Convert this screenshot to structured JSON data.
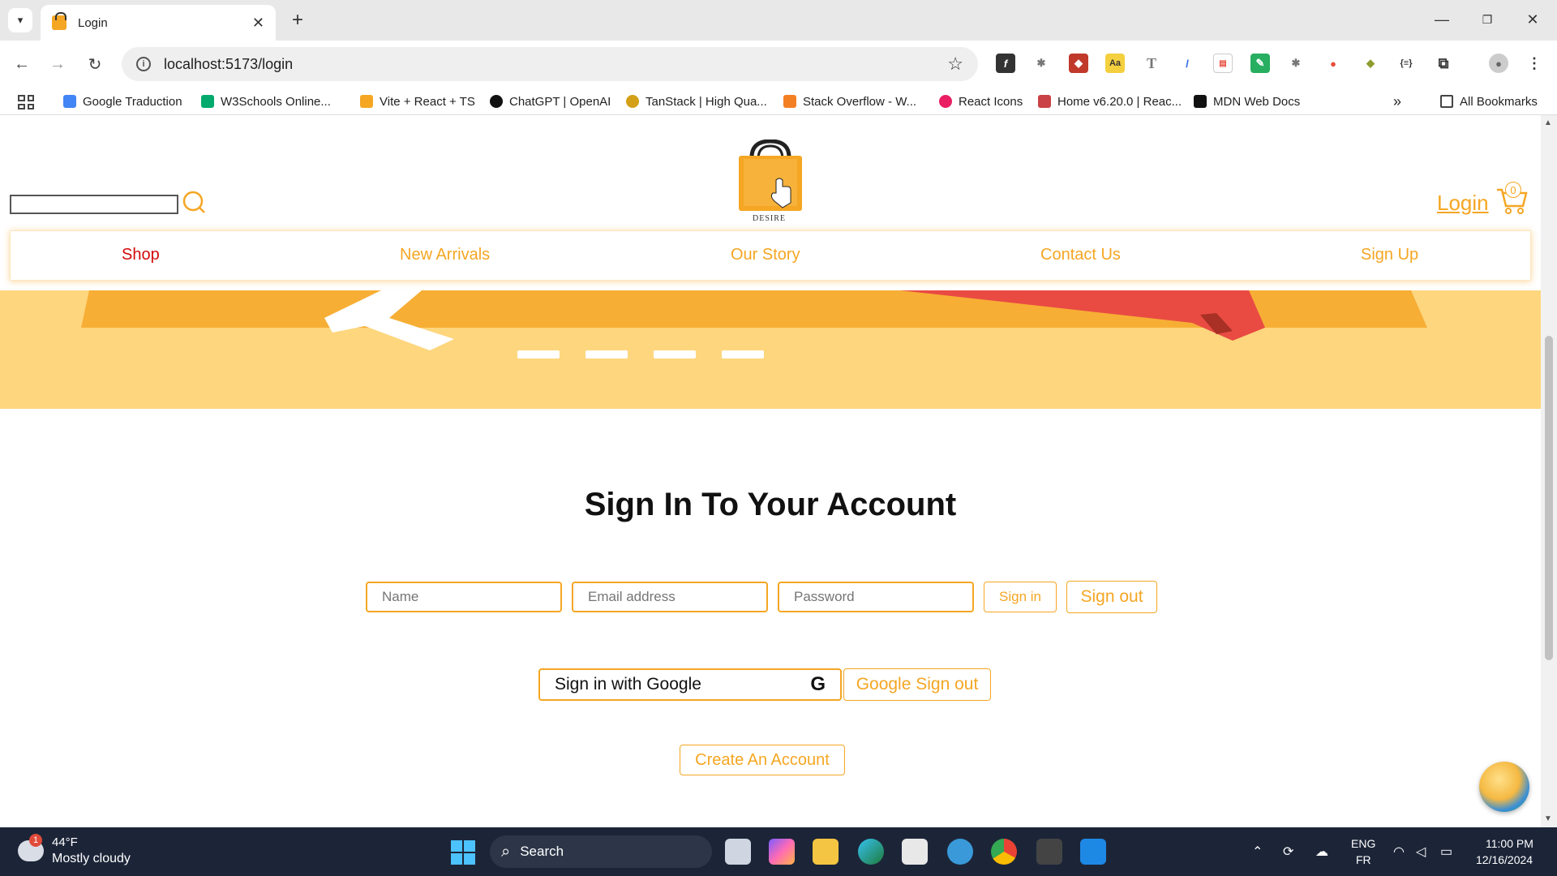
{
  "browser": {
    "tab_title": "Login",
    "url": "localhost:5173/login",
    "bookmarks": [
      "Google Traduction",
      "W3Schools Online...",
      "Vite + React + TS",
      "ChatGPT | OpenAI",
      "TanStack | High Qua...",
      "Stack Overflow - W...",
      "React Icons",
      "Home v6.20.0 | Reac...",
      "MDN Web Docs"
    ],
    "all_bookmarks": "All Bookmarks"
  },
  "site": {
    "logo_text": "DESIRE",
    "login_link": "Login",
    "cart_count": "0",
    "nav": [
      "Shop",
      "New Arrivals",
      "Our Story",
      "Contact Us",
      "Sign Up"
    ],
    "active_nav": "Shop"
  },
  "form": {
    "heading": "Sign In To Your Account",
    "name_placeholder": "Name",
    "email_placeholder": "Email address",
    "password_placeholder": "Password",
    "sign_in": "Sign in",
    "sign_out": "Sign out",
    "google_sign_in": "Sign in with Google",
    "google_g": "G",
    "google_sign_out": "Google Sign out",
    "create_account": "Create An Account"
  },
  "taskbar": {
    "weather_temp": "44°F",
    "weather_desc": "Mostly cloudy",
    "weather_badge": "1",
    "search_label": "Search",
    "lang_1": "ENG",
    "lang_2": "FR",
    "time": "11:00 PM",
    "date": "12/16/2024"
  },
  "colors": {
    "accent": "#f5a623",
    "active_nav": "#d20a0a",
    "banner": "#fdd67e",
    "taskbar": "#1c2538"
  }
}
